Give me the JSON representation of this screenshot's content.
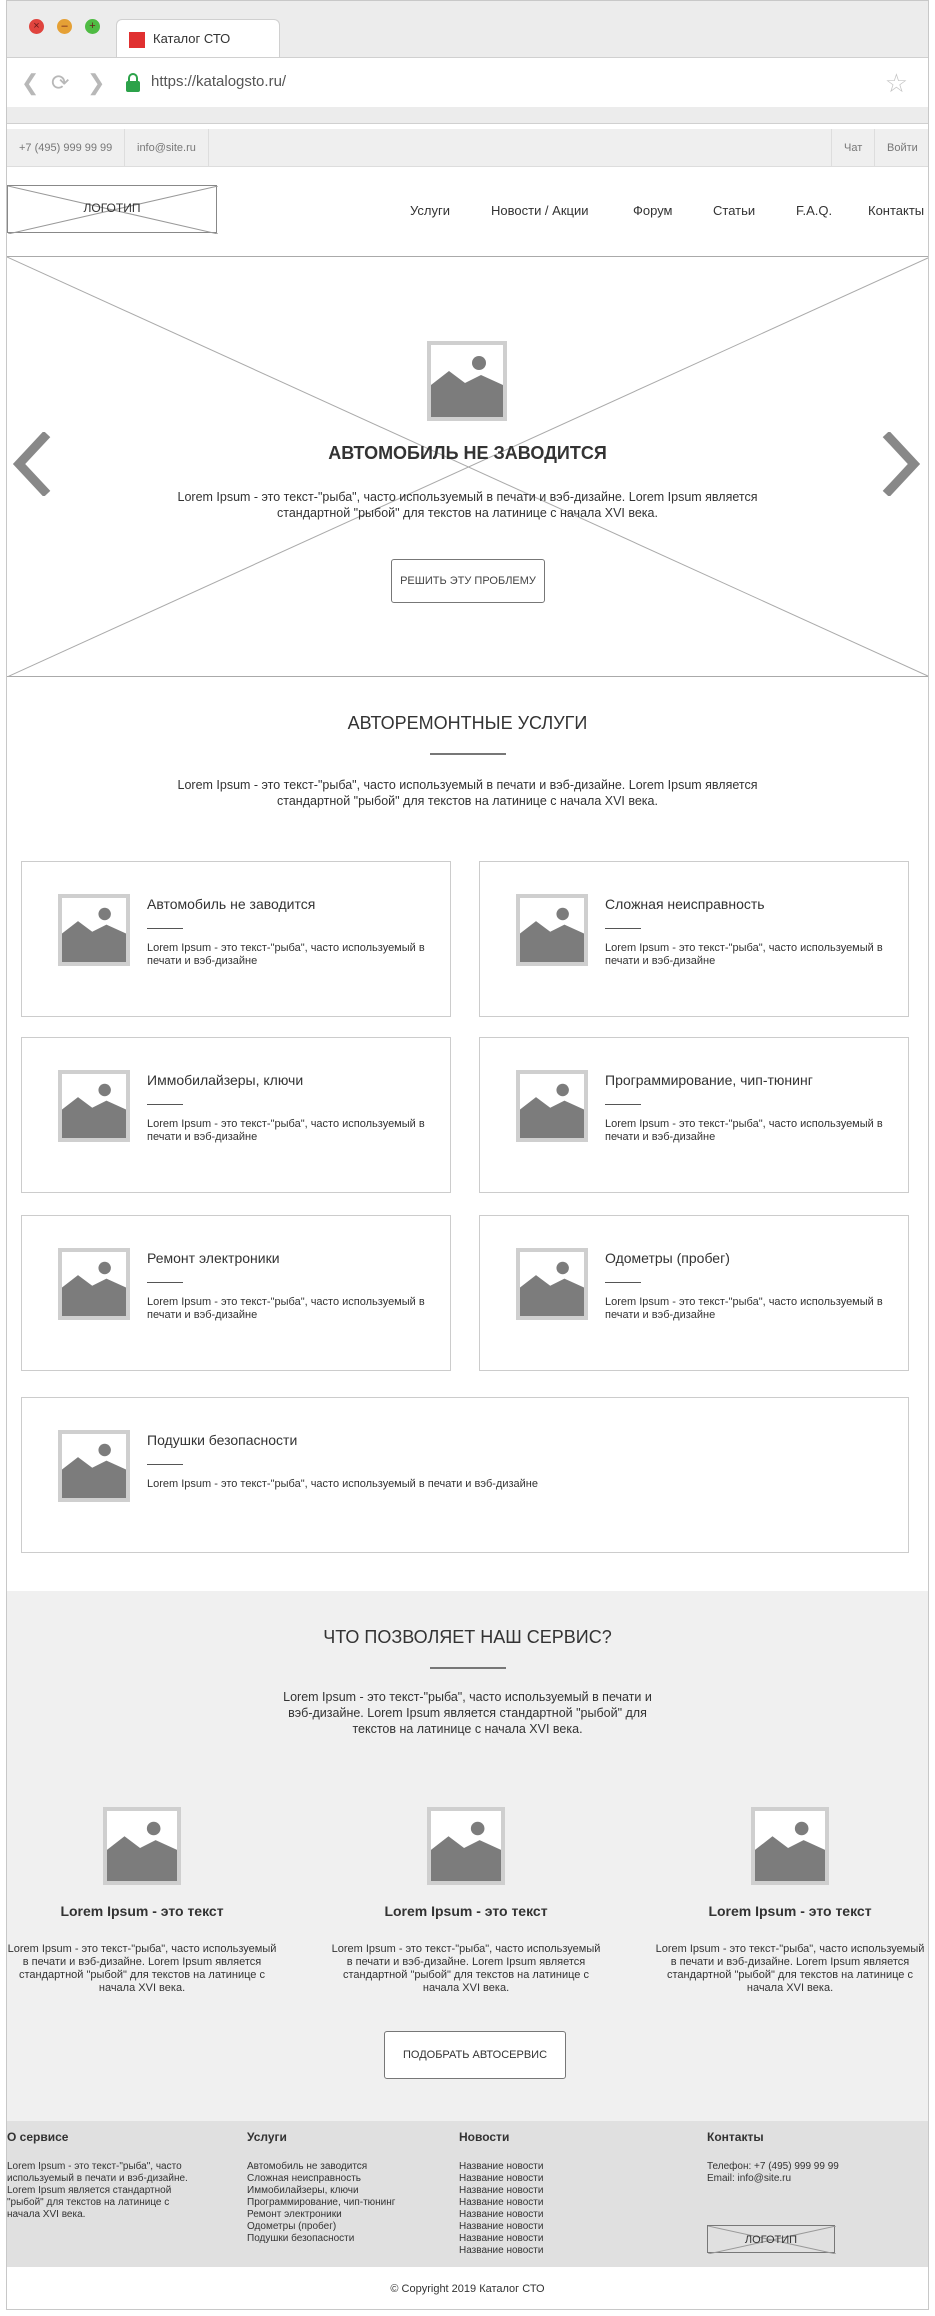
{
  "browser": {
    "tab_title": "Каталог СТО",
    "url": "https://katalogsto.ru/"
  },
  "topbar": {
    "phone": "+7 (495) 999 99 99",
    "email": "info@site.ru",
    "chat": "Чат",
    "login": "Войти"
  },
  "header": {
    "logo": "ЛОГОТИП",
    "menu": [
      "Услуги",
      "Новости / Акции",
      "Форум",
      "Статьи",
      "F.A.Q.",
      "Контакты"
    ]
  },
  "hero": {
    "title": "АВТОМОБИЛЬ НЕ ЗАВОДИТСЯ",
    "text": "Lorem Ipsum - это текст-\"рыба\", часто используемый в печати и вэб-дизайне. Lorem Ipsum является стандартной \"рыбой\" для текстов на латинице с начала XVI века.",
    "button": "РЕШИТЬ ЭТУ ПРОБЛЕМУ"
  },
  "services": {
    "title": "АВТОРЕМОНТНЫЕ УСЛУГИ",
    "text": "Lorem Ipsum - это текст-\"рыба\", часто используемый в печати и вэб-дизайне. Lorem Ipsum является стандартной \"рыбой\" для текстов на латинице с начала XVI века.",
    "items": [
      {
        "title": "Автомобиль не заводится",
        "text": "Lorem Ipsum - это текст-\"рыба\", часто используемый в печати и вэб-дизайне"
      },
      {
        "title": "Сложная неисправность",
        "text": "Lorem Ipsum - это текст-\"рыба\", часто используемый в печати и вэб-дизайне"
      },
      {
        "title": "Иммобилайзеры, ключи",
        "text": "Lorem Ipsum - это текст-\"рыба\", часто используемый в печати и вэб-дизайне"
      },
      {
        "title": "Программирование, чип-тюнинг",
        "text": "Lorem Ipsum - это текст-\"рыба\", часто используемый в печати и вэб-дизайне"
      },
      {
        "title": "Ремонт электроники",
        "text": "Lorem Ipsum - это текст-\"рыба\", часто используемый в печати и вэб-дизайне"
      },
      {
        "title": "Одометры (пробег)",
        "text": "Lorem Ipsum - это текст-\"рыба\", часто используемый в печати и вэб-дизайне"
      },
      {
        "title": "Подушки безопасности",
        "text": "Lorem Ipsum - это текст-\"рыба\", часто используемый в печати и вэб-дизайне"
      }
    ]
  },
  "features": {
    "title": "ЧТО ПОЗВОЛЯЕТ НАШ СЕРВИС?",
    "text": "Lorem Ipsum - это текст-\"рыба\", часто используемый в печати и вэб-дизайне. Lorem Ipsum является стандартной \"рыбой\" для текстов на латинице с начала XVI века.",
    "items": [
      {
        "title": "Lorem Ipsum - это текст",
        "text": "Lorem Ipsum - это текст-\"рыба\", часто используемый в печати и вэб-дизайне. Lorem Ipsum является стандартной \"рыбой\" для текстов на латинице с начала XVI века."
      },
      {
        "title": "Lorem Ipsum - это текст",
        "text": "Lorem Ipsum - это текст-\"рыба\", часто используемый в печати и вэб-дизайне. Lorem Ipsum является стандартной \"рыбой\" для текстов на латинице с начала XVI века."
      },
      {
        "title": "Lorem Ipsum - это текст",
        "text": "Lorem Ipsum - это текст-\"рыба\", часто используемый в печати и вэб-дизайне. Lorem Ipsum является стандартной \"рыбой\" для текстов на латинице с начала XVI века."
      }
    ],
    "button": "ПОДОБРАТЬ АВТОСЕРВИС"
  },
  "footer": {
    "about": {
      "title": "О сервисе",
      "text": "Lorem Ipsum - это текст-\"рыба\", часто используемый в печати и вэб-дизайне. Lorem Ipsum является стандартной \"рыбой\" для текстов на латинице с начала XVI века."
    },
    "services": {
      "title": "Услуги",
      "links": [
        "Автомобиль не заводится",
        "Сложная неисправность",
        "Иммобилайзеры, ключи",
        "Программирование, чип-тюнинг",
        "Ремонт электроники",
        "Одометры (пробег)",
        "Подушки безопасности"
      ]
    },
    "news": {
      "title": "Новости",
      "links": [
        "Название новости",
        "Название новости",
        "Название новости",
        "Название новости",
        "Название новости",
        "Название новости",
        "Название новости",
        "Название новости"
      ]
    },
    "contacts": {
      "title": "Контакты",
      "phone": "Телефон: +7 (495) 999 99 99",
      "email": "Email: info@site.ru"
    },
    "logo": "ЛОГОТИП",
    "copyright": "© Copyright 2019 Каталог СТО"
  }
}
